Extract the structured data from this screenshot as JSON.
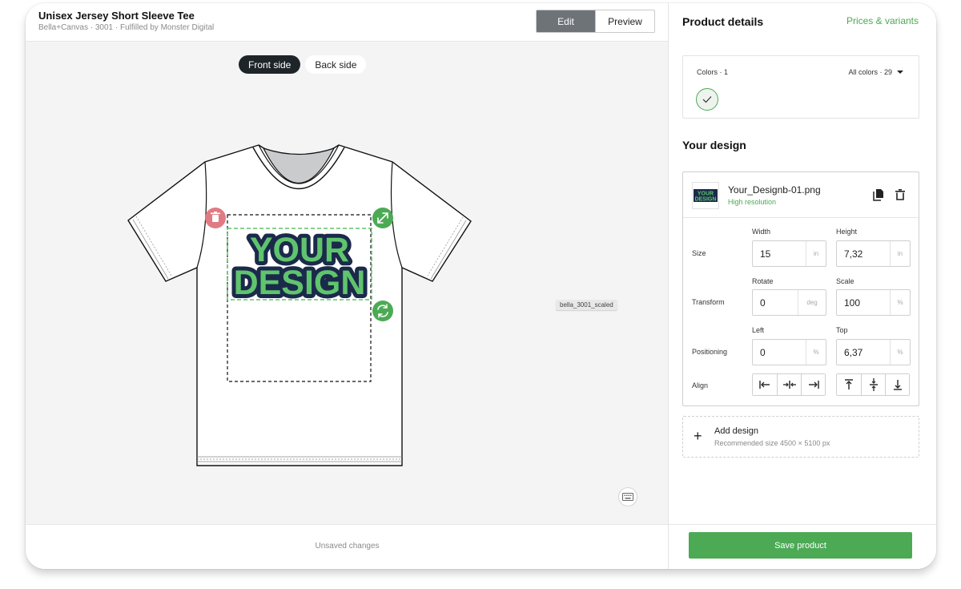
{
  "header": {
    "title": "Unisex Jersey Short Sleeve Tee",
    "subtitle": "Bella+Canvas · 3001 · Fulfilled by Monster Digital",
    "modes": [
      "Edit",
      "Preview"
    ],
    "active_mode": "Edit"
  },
  "canvas": {
    "sides": [
      "Front side",
      "Back side"
    ],
    "active_side": "Front side",
    "design_text_line1": "YOUR",
    "design_text_line2": "DESIGN",
    "layer_tag": "bella_3001_scaled",
    "status": "Unsaved changes"
  },
  "panel": {
    "title": "Product details",
    "prices_link": "Prices & variants",
    "colors_label": "Colors · 1",
    "all_colors": "All colors · 29",
    "your_design_title": "Your design",
    "file": {
      "name": "Your_Designb-01.png",
      "resolution": "High resolution",
      "thumb_line1": "YOUR",
      "thumb_line2": "DESIGN"
    },
    "size": {
      "label": "Size",
      "width_title": "Width",
      "width_value": "15",
      "width_unit": "in",
      "height_title": "Height",
      "height_value": "7,32",
      "height_unit": "in"
    },
    "transform": {
      "label": "Transform",
      "rotate_title": "Rotate",
      "rotate_value": "0",
      "rotate_unit": "deg",
      "scale_title": "Scale",
      "scale_value": "100",
      "scale_unit": "%"
    },
    "positioning": {
      "label": "Positioning",
      "left_title": "Left",
      "left_value": "0",
      "left_unit": "%",
      "top_title": "Top",
      "top_value": "6,37",
      "top_unit": "%"
    },
    "align_label": "Align",
    "add_design": {
      "plus": "+",
      "title": "Add design",
      "subtitle": "Recommended size 4500 × 5100 px"
    },
    "save_label": "Save product"
  },
  "colors": {
    "accent": "#4caa55",
    "design_fill": "#5fc46d",
    "design_outline": "#1b2a4a",
    "delete_handle": "#e07b84",
    "dark_pill": "#1e2529"
  },
  "icons": [
    "trash-icon",
    "resize-icon",
    "rotate-icon",
    "keyboard-icon",
    "copy-icon",
    "check-icon",
    "chevron-down-icon",
    "plus-icon",
    "align-left-icon",
    "align-center-h-icon",
    "align-right-icon",
    "align-top-icon",
    "align-center-v-icon",
    "align-bottom-icon"
  ]
}
